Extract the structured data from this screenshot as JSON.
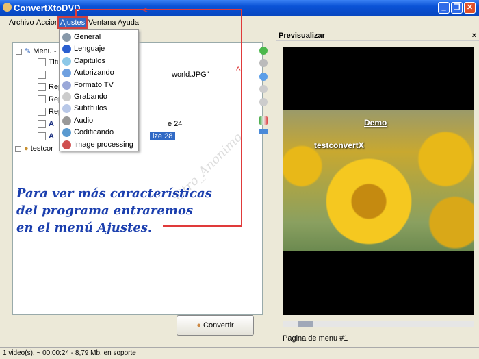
{
  "window": {
    "title": "ConvertXtoDVD"
  },
  "menubar": [
    "Archivo",
    "Accion",
    "Ajustes",
    "Ventana",
    "Ayuda"
  ],
  "dropdown": [
    {
      "label": "General",
      "color": "#8899aa"
    },
    {
      "label": "Lenguaje",
      "color": "#2a5fd0"
    },
    {
      "label": "Capitulos",
      "color": "#8cc8e8"
    },
    {
      "label": "Autorizando",
      "color": "#6ea0e0"
    },
    {
      "label": "Formato TV",
      "color": "#9aa8d8"
    },
    {
      "label": "Grabando",
      "color": "#cccccc"
    },
    {
      "label": "Subtitulos",
      "color": "#b8c8e8"
    },
    {
      "label": "Audio",
      "color": "#999999"
    },
    {
      "label": "Codificando",
      "color": "#5a9ad0"
    },
    {
      "label": "Image processing",
      "color": "#d05050"
    }
  ],
  "tree": {
    "root": "Menu -",
    "items": [
      "Titu",
      "world.JPG\"",
      "Rep",
      "Rep",
      "Rep",
      "e 24",
      "ize 28"
    ],
    "project": "testcor"
  },
  "watermark": "Otro_Anonimo",
  "preview": {
    "title": "Previsualizar",
    "close": "×",
    "overlay_demo": "Demo",
    "overlay_title": "testconvertX",
    "page_label": "Pagina de menu #1",
    "slider_position": 0.08
  },
  "convert_label": "Convertir",
  "status": "1 video(s), ~ 00:00:24 - 8,79 Mb. en soporte",
  "note": [
    "Para ver más características",
    "del programa entraremos",
    "en el menú Ajustes."
  ]
}
